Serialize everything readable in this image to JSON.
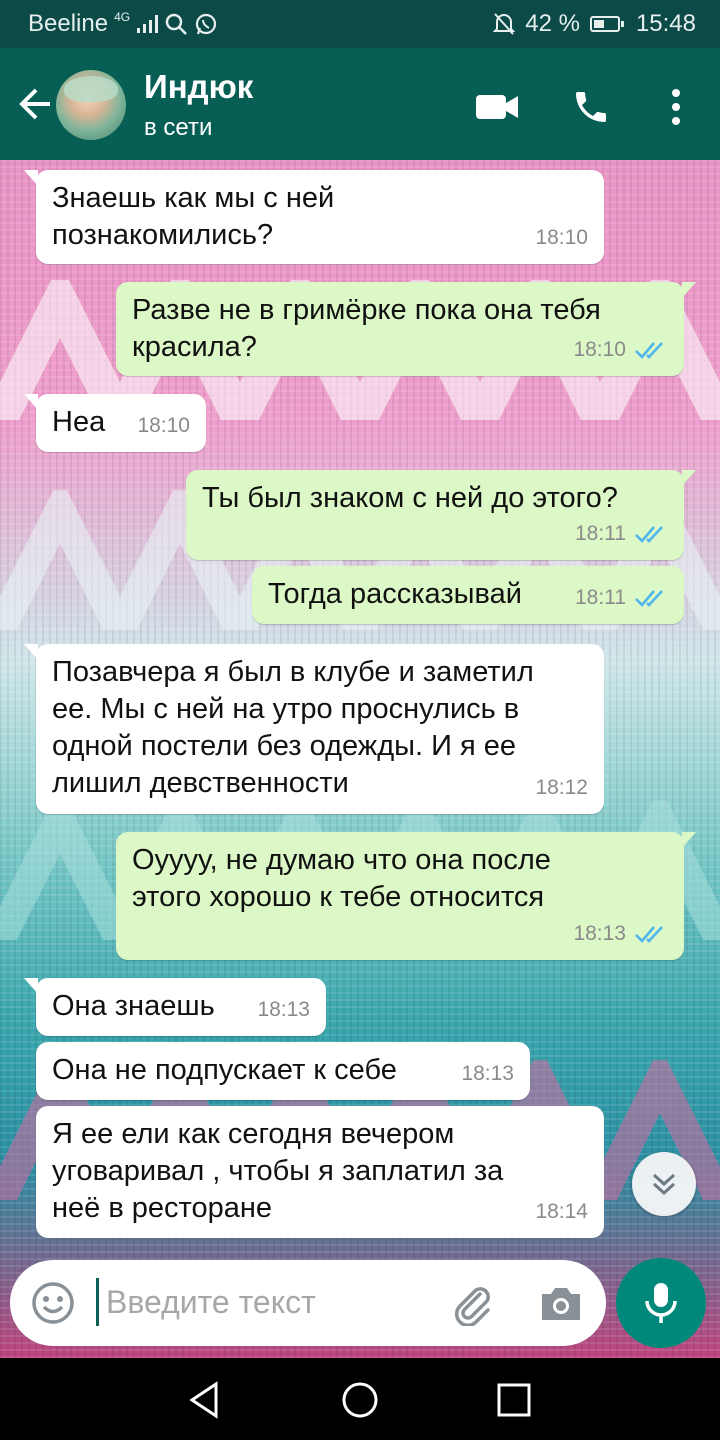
{
  "status_bar": {
    "carrier": "Beeline",
    "network": "4G",
    "battery": "42 %",
    "time": "15:48"
  },
  "header": {
    "contact_name": "Индюк",
    "contact_status": "в сети"
  },
  "messages": [
    {
      "dir": "in",
      "text": "Знаешь как мы с ней\nпознакомились?",
      "time": "18:10"
    },
    {
      "dir": "out",
      "text": "Разве не в гримёрке пока она тебя\nкрасила?",
      "time": "18:10",
      "read": true
    },
    {
      "dir": "in",
      "text": "Неа",
      "time": "18:10"
    },
    {
      "dir": "out",
      "text": "Ты был знаком с ней до этого?",
      "time": "18:11",
      "read": true
    },
    {
      "dir": "out",
      "text": "Тогда рассказывай",
      "time": "18:11",
      "read": true
    },
    {
      "dir": "in",
      "text": "Позавчера я был в клубе и заметил\nее. Мы с ней на утро проснулись в\nодной постели без одежды. И я ее\nлишил девственности",
      "time": "18:12"
    },
    {
      "dir": "out",
      "text": "Оуууу, не думаю что она после\nэтого хорошо к тебе относится",
      "time": "18:13",
      "read": true
    },
    {
      "dir": "in",
      "text": "Она знаешь",
      "time": "18:13"
    },
    {
      "dir": "in",
      "text": "Она не подпускает к себе",
      "time": "18:13"
    },
    {
      "dir": "in",
      "text": "Я ее ели как сегодня вечером\nуговаривал , чтобы я заплатил за\nнеё в ресторане",
      "time": "18:14"
    }
  ],
  "input": {
    "placeholder": "Введите текст"
  },
  "colors": {
    "header": "#075e54",
    "status_bar": "#0b4a47",
    "outgoing_bubble": "#dcf8c6",
    "incoming_bubble": "#ffffff",
    "read_ticks": "#4fb6ec",
    "mic_button": "#00897b"
  },
  "icons": [
    "signal-icon",
    "search-icon",
    "whatsapp-icon",
    "mute-icon",
    "battery-icon",
    "back-arrow-icon",
    "video-call-icon",
    "phone-icon",
    "more-vert-icon",
    "double-check-icon",
    "chevron-double-down-icon",
    "emoji-icon",
    "attach-icon",
    "camera-icon",
    "mic-icon",
    "nav-back-icon",
    "nav-home-icon",
    "nav-recents-icon"
  ]
}
